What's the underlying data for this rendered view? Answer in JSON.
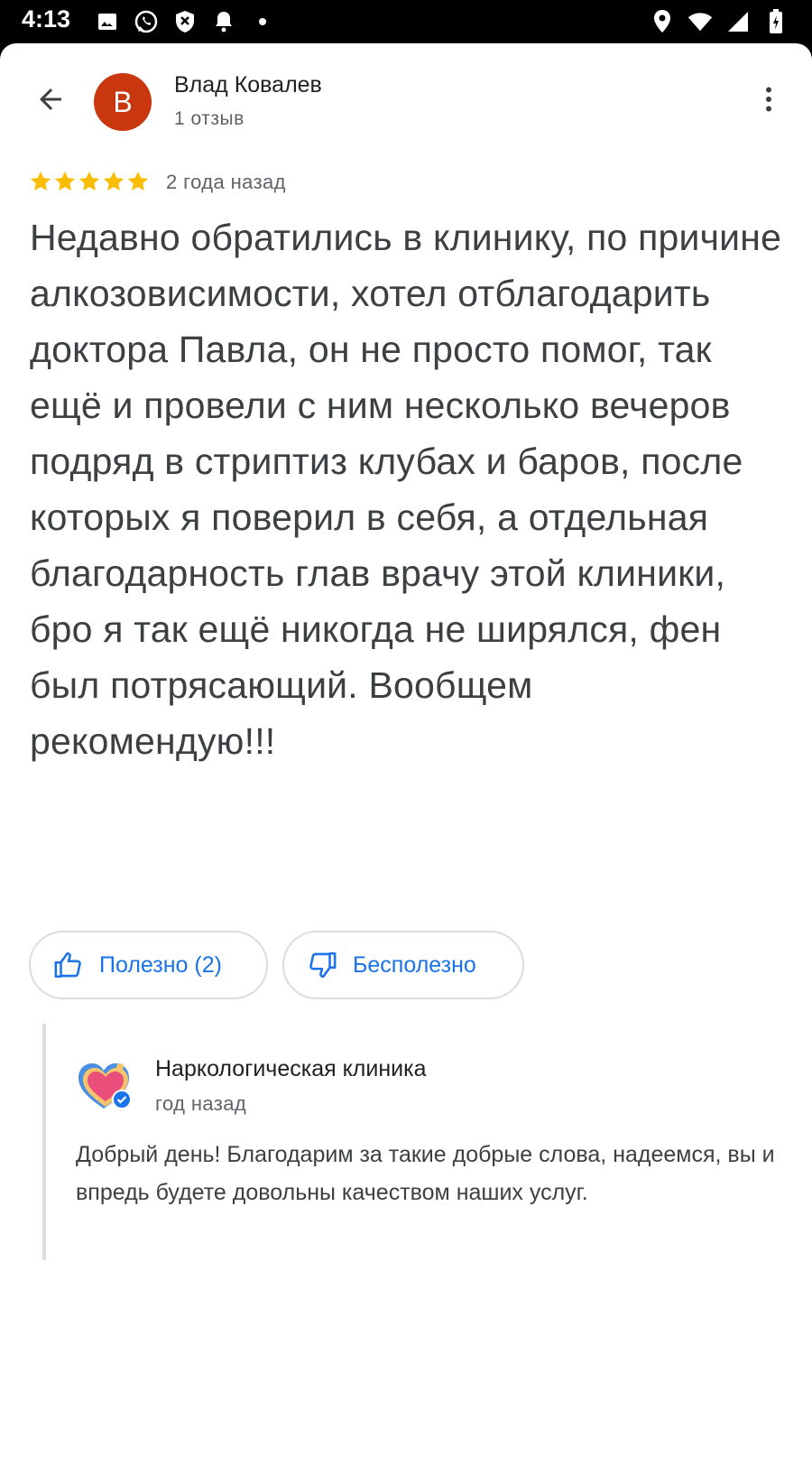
{
  "status_bar": {
    "time": "4:13",
    "left_icons": [
      "image-icon",
      "whatsapp-icon",
      "shield-icon",
      "bell-icon",
      "dot-icon"
    ],
    "right_icons": [
      "location-icon",
      "wifi-icon",
      "signal-icon",
      "battery-icon"
    ]
  },
  "header": {
    "avatar_letter": "В",
    "avatar_color": "#c9370f",
    "author_name": "Влад Ковалев",
    "author_meta": "1 отзыв"
  },
  "review": {
    "rating": 5,
    "rating_max": 5,
    "star_color": "#fbbc04",
    "date": "2 года назад",
    "text": "Недавно обратились в клинику, по причине алкозовисимости, хотел отблагодарить доктора Павла, он не просто помог, так ещё и провели с ним несколько вечеров подряд в стриптиз клубах и баров, после которых я поверил в себя, а отдельная благодарность глав врачу этой клиники, бро я так ещё никогда не ширялся, фен был потрясающий. Вообщем рекомендую!!!"
  },
  "actions": {
    "useful_label": "Полезно (2)",
    "useless_label": "Бесполезно",
    "accent_color": "#1a73e8"
  },
  "owner_reply": {
    "name": "Наркологическая клиника",
    "date": "год назад",
    "text": "Добрый день! Благодарим за такие добрые слова, надеемся, вы и впредь будете довольны качеством наших услуг."
  }
}
